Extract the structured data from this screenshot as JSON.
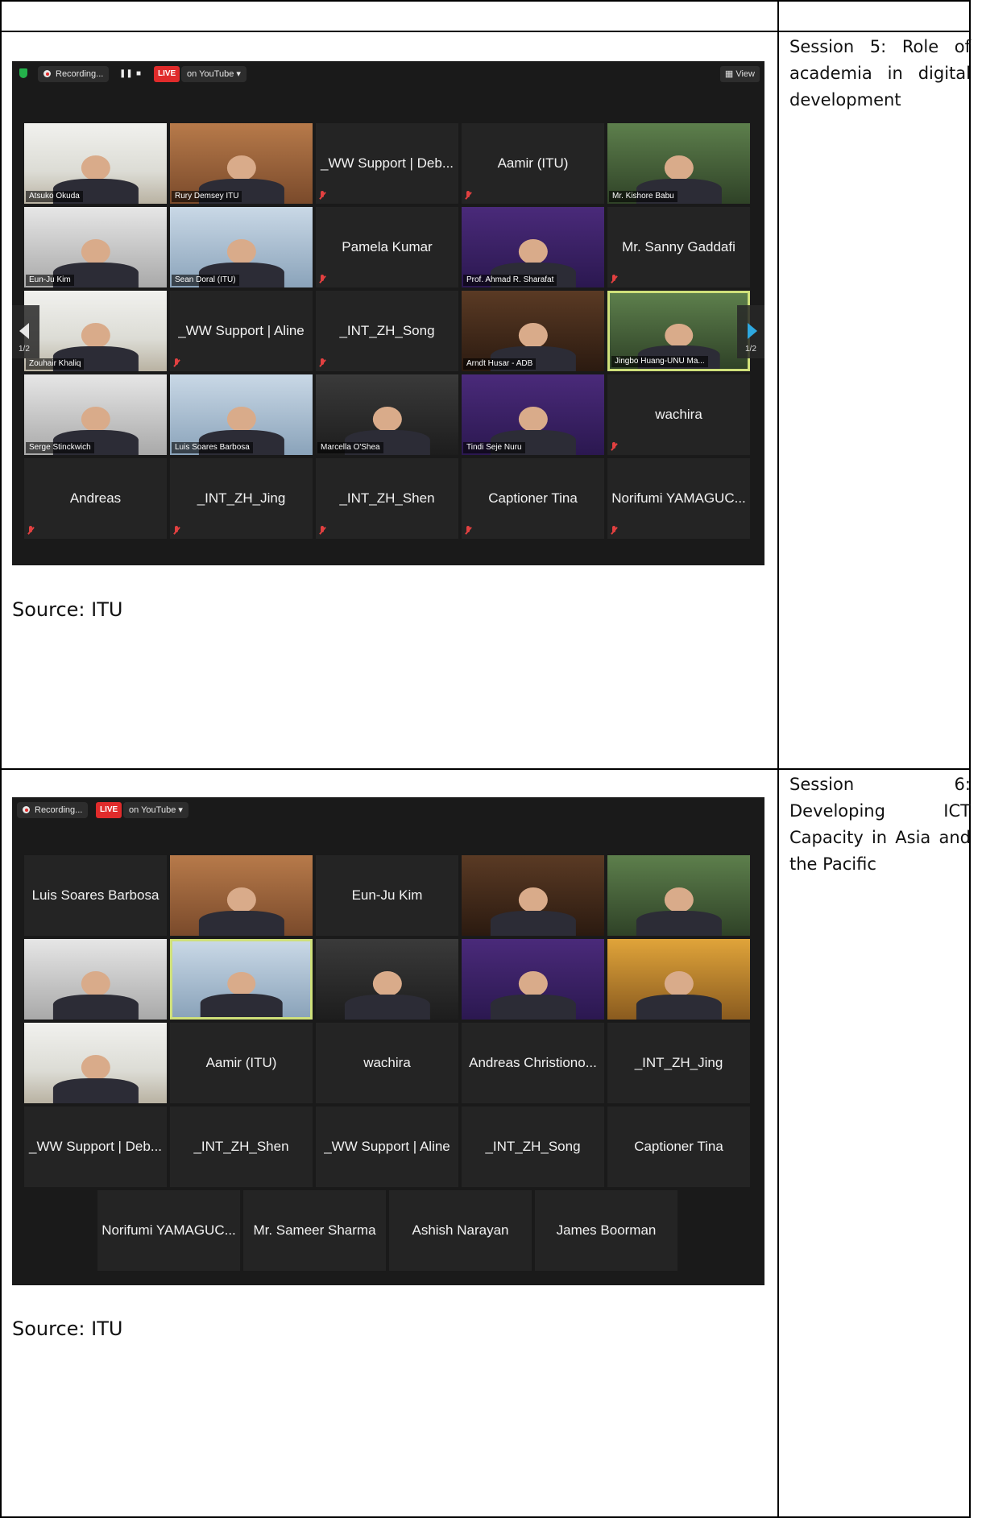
{
  "rows": [
    {
      "session_label": "Session 5: Role of academia in digital development",
      "source": "Source: ITU",
      "zoom": {
        "recording": "Recording...",
        "live": "LIVE",
        "youtube": "on YouTube",
        "view": "View",
        "page_left": "1/2",
        "page_right": "1/2",
        "tiles": [
          {
            "name": "Atsuko Okuda",
            "video": true
          },
          {
            "name": "Rury Demsey ITU",
            "video": true
          },
          {
            "name": "_WW Support | Deb...",
            "video": false
          },
          {
            "name": "Aamir (ITU)",
            "video": false
          },
          {
            "name": "Mr. Kishore Babu",
            "video": true
          },
          {
            "name": "Eun-Ju Kim",
            "video": true
          },
          {
            "name": "Sean Doral (ITU)",
            "video": true
          },
          {
            "name": "Pamela Kumar",
            "video": false
          },
          {
            "name": "Prof. Ahmad R. Sharafat",
            "video": true
          },
          {
            "name": "Mr. Sanny Gaddafi",
            "video": false
          },
          {
            "name": "Zouhair Khaliq",
            "video": true
          },
          {
            "name": "_WW Support | Aline",
            "video": false
          },
          {
            "name": "_INT_ZH_Song",
            "video": false
          },
          {
            "name": "Arndt Husar - ADB",
            "video": true
          },
          {
            "name": "Jingbo Huang-UNU Ma...",
            "video": true
          },
          {
            "name": "Serge Stinckwich",
            "video": true
          },
          {
            "name": "Luis Soares Barbosa",
            "video": true
          },
          {
            "name": "Marcella O'Shea",
            "video": true
          },
          {
            "name": "Tindi Seje Nuru",
            "video": true
          },
          {
            "name": "wachira",
            "video": false
          },
          {
            "name": "Andreas",
            "video": false
          },
          {
            "name": "_INT_ZH_Jing",
            "video": false
          },
          {
            "name": "_INT_ZH_Shen",
            "video": false
          },
          {
            "name": "Captioner Tina",
            "video": false
          },
          {
            "name": "Norifumi YAMAGUC...",
            "video": false
          }
        ]
      }
    },
    {
      "session_label": "Session 6: Developing ICT Capacity in Asia and the Pacific",
      "source": "Source: ITU",
      "zoom": {
        "recording": "Recording...",
        "live": "LIVE",
        "youtube": "on YouTube",
        "tiles": [
          {
            "name": "Luis Soares Barbosa",
            "video": false
          },
          {
            "name": "",
            "video": true
          },
          {
            "name": "Eun-Ju Kim",
            "video": false
          },
          {
            "name": "",
            "video": true
          },
          {
            "name": "",
            "video": true
          },
          {
            "name": "",
            "video": true
          },
          {
            "name": "",
            "video": true
          },
          {
            "name": "",
            "video": true
          },
          {
            "name": "",
            "video": true
          },
          {
            "name": "",
            "video": true
          },
          {
            "name": "",
            "video": true
          },
          {
            "name": "Aamir (ITU)",
            "video": false
          },
          {
            "name": "wachira",
            "video": false
          },
          {
            "name": "Andreas Christiono...",
            "video": false
          },
          {
            "name": "_INT_ZH_Jing",
            "video": false
          },
          {
            "name": "_WW Support | Deb...",
            "video": false
          },
          {
            "name": "_INT_ZH_Shen",
            "video": false
          },
          {
            "name": "_WW Support | Aline",
            "video": false
          },
          {
            "name": "_INT_ZH_Song",
            "video": false
          },
          {
            "name": "Captioner Tina",
            "video": false
          },
          {
            "name": "Norifumi YAMAGUC...",
            "video": false
          },
          {
            "name": "Mr. Sameer Sharma",
            "video": false
          },
          {
            "name": "Ashish Narayan",
            "video": false
          },
          {
            "name": "James Boorman",
            "video": false
          }
        ]
      }
    }
  ]
}
